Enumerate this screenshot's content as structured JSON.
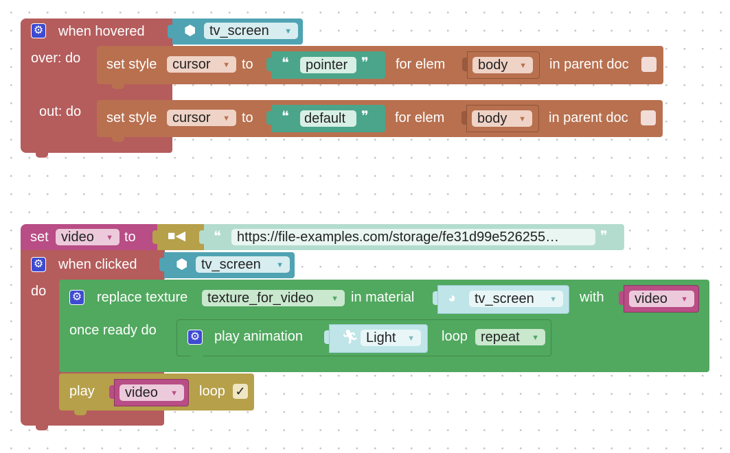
{
  "hover_event": {
    "label": "when hovered",
    "object": "tv_screen",
    "over_label": "over: do",
    "out_label": "out: do"
  },
  "over_stmt": {
    "set_style": "set style",
    "property": "cursor",
    "to": "to",
    "value": "pointer",
    "for_elem": "for elem",
    "elem": "body",
    "in_parent_doc": "in parent doc",
    "checked": false
  },
  "out_stmt": {
    "set_style": "set style",
    "property": "cursor",
    "to": "to",
    "value": "default",
    "for_elem": "for elem",
    "elem": "body",
    "in_parent_doc": "in parent doc",
    "checked": false
  },
  "set_video": {
    "set": "set",
    "variable": "video",
    "to": "to",
    "url": "https://file-examples.com/storage/fe31d99e526255…"
  },
  "click_event": {
    "label": "when clicked",
    "object": "tv_screen",
    "do": "do"
  },
  "replace_texture": {
    "label": "replace texture",
    "texture": "texture_for_video",
    "in_material": "in material",
    "material": "tv_screen",
    "with": "with",
    "with_var": "video",
    "once_ready": "once ready do"
  },
  "play_animation": {
    "label": "play animation",
    "animation": "Light",
    "loop": "loop",
    "loop_mode": "repeat"
  },
  "play_video": {
    "play": "play",
    "variable": "video",
    "loop": "loop",
    "check_mark": "✓"
  },
  "glyphs": {
    "arrow": "▼",
    "quote_open": "❝",
    "quote_close": "❞",
    "gear": "⚙"
  },
  "colors": {
    "event_red": "#b55c5c",
    "style_orange": "#b8704f",
    "object_teal": "#4fa3b2",
    "string_green": "#4aa58a",
    "texture_green": "#51a85f",
    "video_olive": "#b6a04a",
    "variable_pink": "#b94d85",
    "gear_blue": "#3d4bd1"
  },
  "icons": {
    "object": "cube-icon",
    "video": "video-camera-icon",
    "material": "material-ball-icon",
    "animation": "running-figure-icon",
    "settings": "gear-icon"
  }
}
